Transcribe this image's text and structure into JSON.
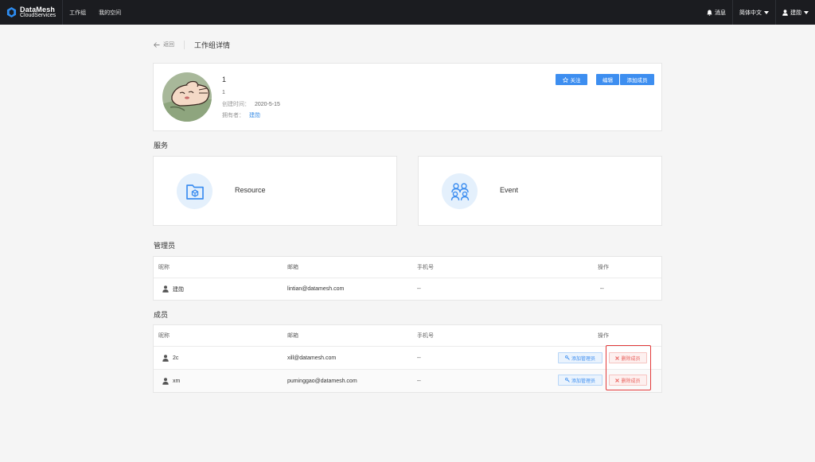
{
  "topbar": {
    "logo_line1": "DataMesh",
    "logo_line2": "CloudServices",
    "nav": [
      "工作组",
      "我的空间"
    ],
    "messages": "消息",
    "language": "简体中文",
    "user": "建勋"
  },
  "header": {
    "back": "返回",
    "title": "工作组详情"
  },
  "group": {
    "name": "1",
    "description": "1",
    "created_label": "创建时间：",
    "created_value": "2020-5-15",
    "owner_label": "拥有者：",
    "owner_value": "建勋",
    "follow_button": "关注",
    "edit_button": "编辑",
    "add_member_button": "添加成员"
  },
  "services": {
    "title": "服务",
    "items": [
      {
        "name": "Resource",
        "icon": "folder-icon"
      },
      {
        "name": "Event",
        "icon": "people-group-icon"
      }
    ]
  },
  "admins": {
    "title": "管理员",
    "columns": [
      "昵称",
      "邮箱",
      "手机号",
      "操作"
    ],
    "rows": [
      {
        "name": "建勋",
        "email": "lintian@datamesh.com",
        "phone": "--",
        "action": "--"
      }
    ]
  },
  "members": {
    "title": "成员",
    "columns": [
      "昵称",
      "邮箱",
      "手机号",
      "操作"
    ],
    "add_admin_label": "添加管理员",
    "remove_label": "删除成员",
    "rows": [
      {
        "name": "2c",
        "email": "xill@datamesh.com",
        "phone": "--"
      },
      {
        "name": "xm",
        "email": "puminggao@datamesh.com",
        "phone": "--"
      }
    ]
  },
  "colors": {
    "topbar": "#1b1c20",
    "primary": "#3d8ef0",
    "danger": "#e9625d",
    "highlight": "#e33b3b"
  }
}
